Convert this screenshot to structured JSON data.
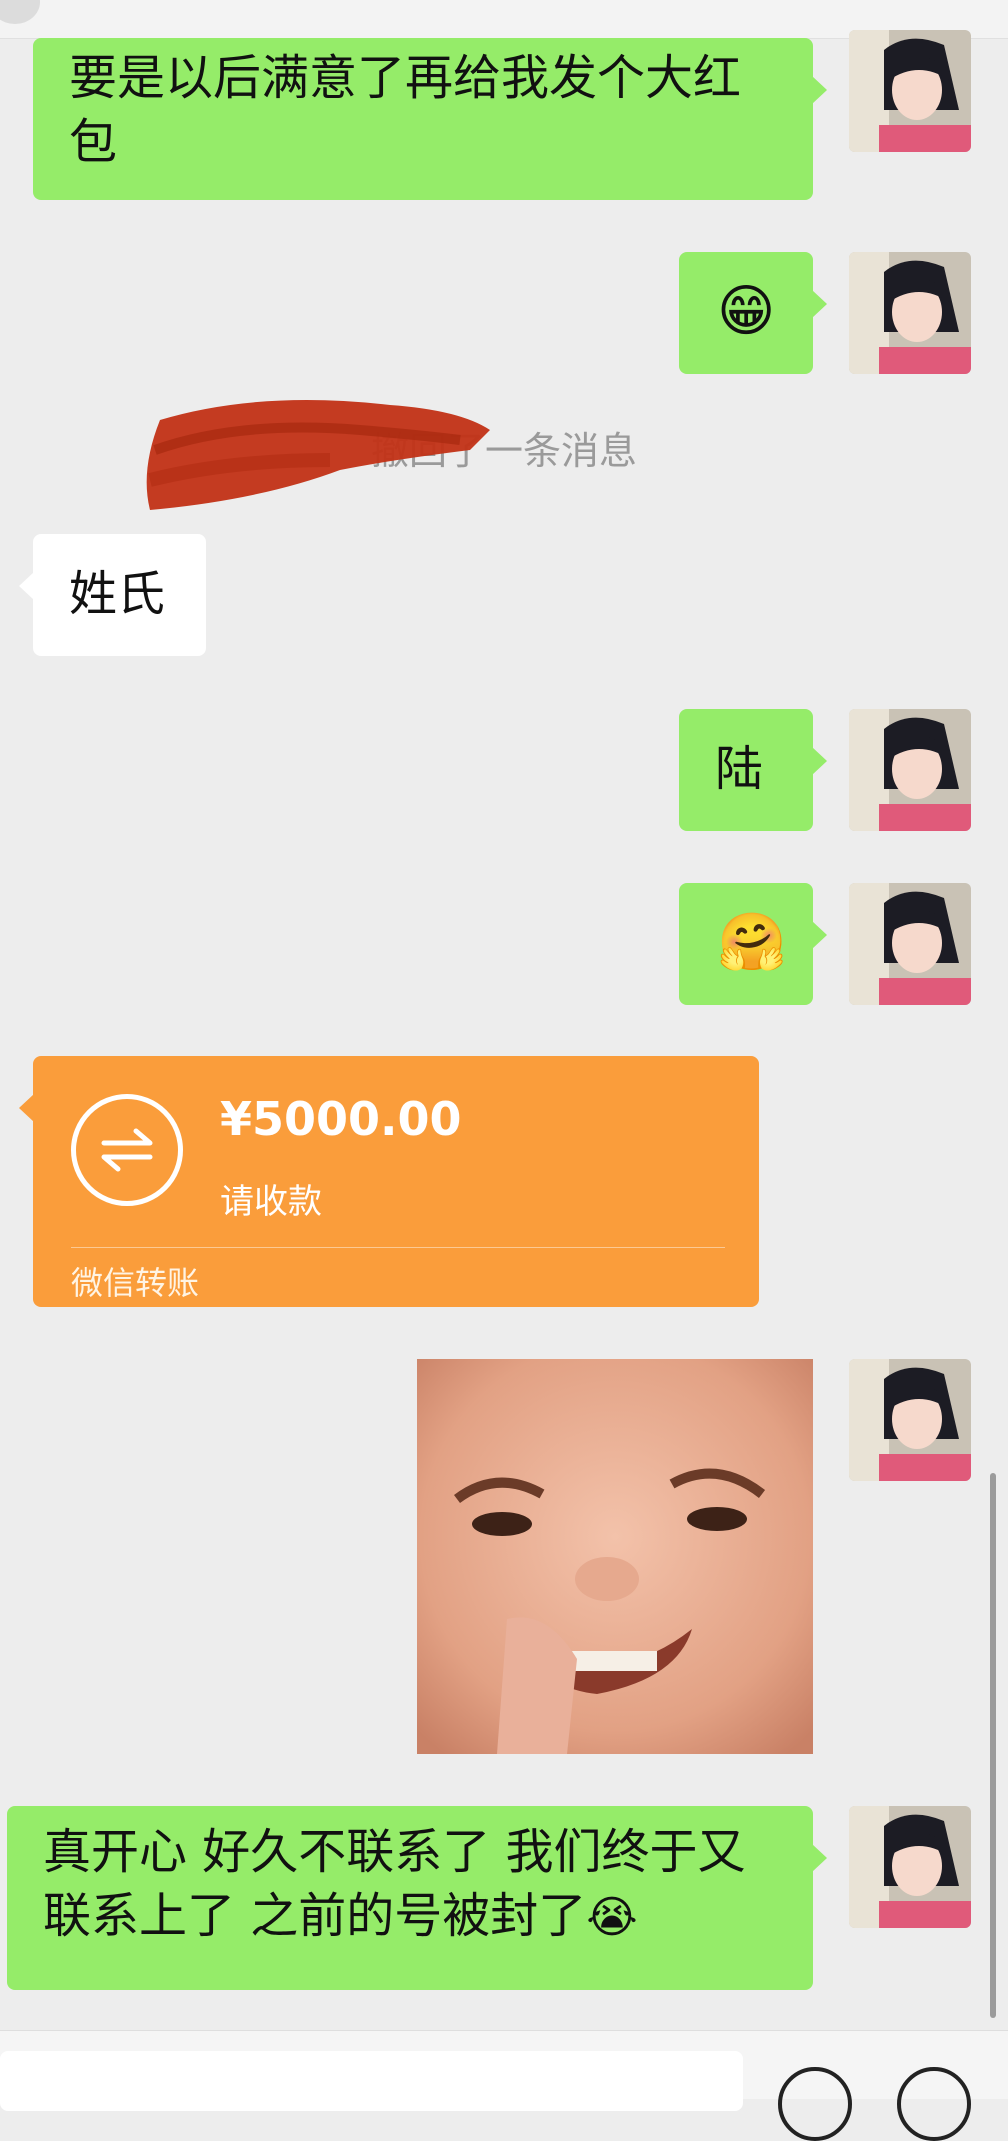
{
  "messages": {
    "m1_text": "要是以后满意了再给我发个大红包",
    "m2_emoji": "😁",
    "system_notice": "撤回了一条消息",
    "m3_text": "姓氏",
    "m4_text": "陆",
    "m5_emoji": "🤗",
    "transfer": {
      "amount": "¥5000.00",
      "note": "请收款",
      "brand": "微信转账"
    },
    "m7_line1": "真开心 好久不联系了 我们终于又",
    "m7_line2": "联系上了 之前的号被封了",
    "m7_emoji": "😭"
  },
  "colors": {
    "background": "#ededed",
    "sent_bubble": "#95ec69",
    "received_bubble": "#ffffff",
    "transfer_bubble": "#fa9d3b"
  },
  "icons": [
    "avatar",
    "transfer-icon",
    "voice-icon",
    "add-icon"
  ]
}
